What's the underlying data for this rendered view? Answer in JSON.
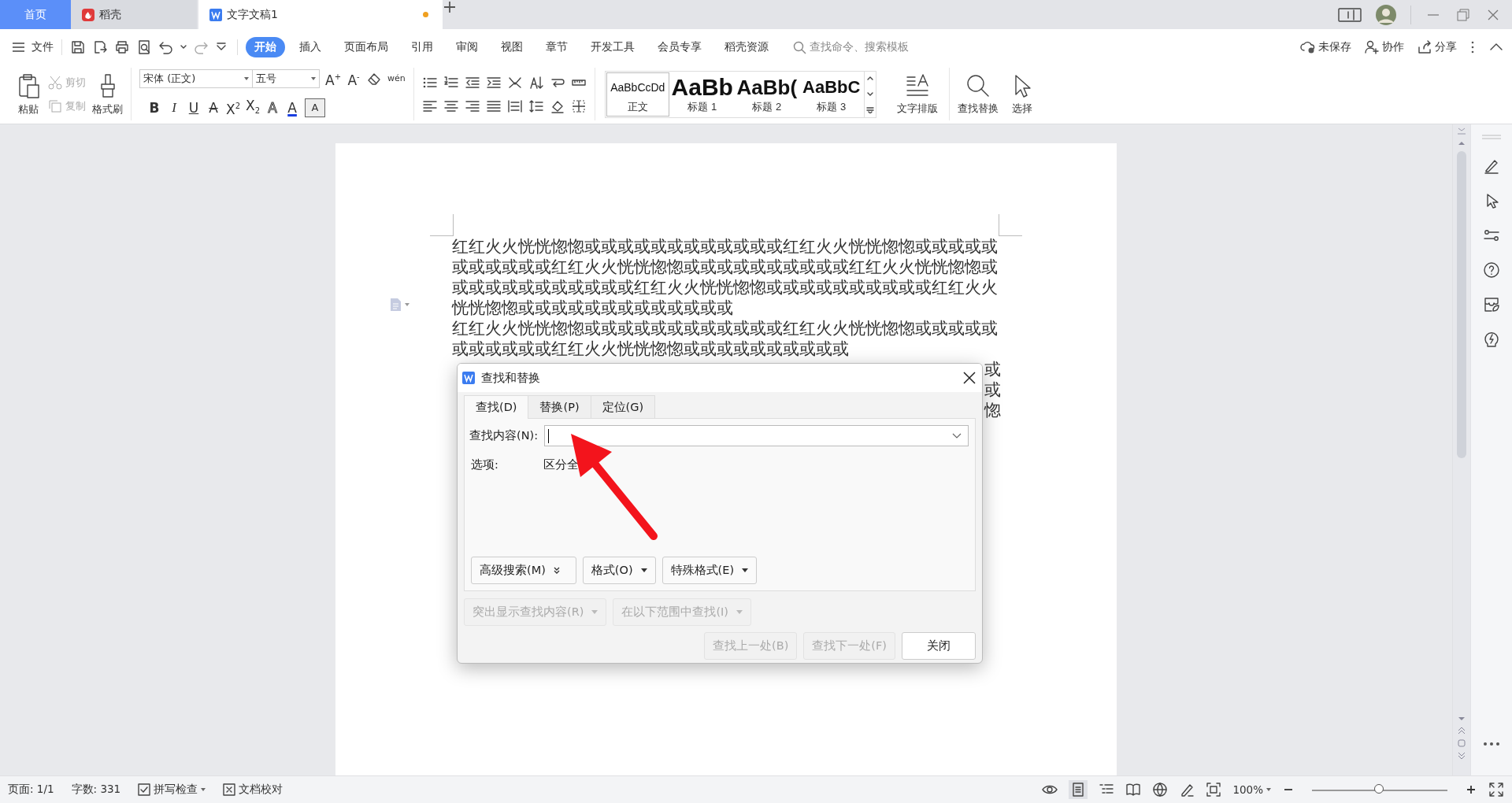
{
  "tabs": [
    {
      "label": "首页",
      "kind": "home",
      "selected": false
    },
    {
      "label": "稻壳",
      "kind": "app",
      "selected": false
    },
    {
      "label": "文字文稿1",
      "kind": "doc",
      "selected": true,
      "unsaved": true
    }
  ],
  "menu": {
    "file": "文件",
    "tabs": [
      {
        "label": "开始",
        "selected": true
      },
      {
        "label": "插入",
        "selected": false
      },
      {
        "label": "页面布局",
        "selected": false
      },
      {
        "label": "引用",
        "selected": false
      },
      {
        "label": "审阅",
        "selected": false
      },
      {
        "label": "视图",
        "selected": false
      },
      {
        "label": "章节",
        "selected": false
      },
      {
        "label": "开发工具",
        "selected": false
      },
      {
        "label": "会员专享",
        "selected": false
      },
      {
        "label": "稻壳资源",
        "selected": false
      }
    ],
    "search": {
      "placeholder": "查找命令、搜索模板"
    },
    "actions": [
      {
        "label": "未保存",
        "kind": "cloud"
      },
      {
        "label": "协作",
        "kind": "people"
      },
      {
        "label": "分享",
        "kind": "share"
      }
    ]
  },
  "ribbon": {
    "paste": "粘贴",
    "clip": [
      {
        "label": "剪切",
        "kind": "cut",
        "disabled": true
      },
      {
        "label": "复制",
        "kind": "copy",
        "disabled": true
      }
    ],
    "format_painter": "格式刷",
    "font": "宋体 (正文)",
    "size": "五号",
    "font_tools": [
      {
        "label": "B",
        "kind": "bold"
      },
      {
        "label": "I",
        "kind": "italic"
      },
      {
        "label": "U",
        "kind": "underline"
      },
      {
        "label": "A",
        "kind": "strike"
      },
      {
        "label": "X$^{2}$",
        "kind": "plain"
      },
      {
        "label": "X$_{2}$",
        "kind": "plain"
      },
      {
        "label": "A",
        "kind": "effect"
      },
      {
        "label": "A",
        "kind": "color"
      },
      {
        "label": "A",
        "kind": "boxed"
      }
    ],
    "grow_tools": [
      {
        "label": "A$^{+}$"
      },
      {
        "label": "A$^{-}$"
      }
    ],
    "pinyin": "wén",
    "styles": [
      {
        "preview": "AaBbCcDd",
        "label": "正文",
        "kind": "body",
        "selected": true
      },
      {
        "preview": "AaBb",
        "label": "标题 1",
        "kind": "h1",
        "selected": false
      },
      {
        "preview": "AaBb(",
        "label": "标题 2",
        "kind": "h2",
        "selected": false
      },
      {
        "preview": "AaBbC",
        "label": "标题 3",
        "kind": "h3",
        "selected": false
      }
    ],
    "text_layout": "文字排版",
    "find_replace": "查找替换",
    "select": "选择"
  },
  "document": {
    "paragraphs": [
      "红红火火恍恍惚惚或或或或或或或或或或或或红红火火恍恍惚惚或或或或或或或或或或或红红火火恍恍惚惚或或或或或或或或或或红红火火恍恍惚惚或或或或或或或或或或或或红红火火恍恍惚惚或或或或或或或或或或红红火火恍恍惚惚或或或或或或或或或或或或或",
      "红红火火恍恍惚惚或或或或或或或或或或或或红红火火恍恍惚惚或或或或或或或或或或或红红火火恍恍惚惚或或或或或或或或或或"
    ],
    "hidden_line_ends": [
      "或",
      "或",
      "惚"
    ]
  },
  "dialog": {
    "title": "查找和替换",
    "tabs": [
      {
        "label": "查找(D)",
        "selected": true
      },
      {
        "label": "替换(P)",
        "selected": false
      },
      {
        "label": "定位(G)",
        "selected": false
      }
    ],
    "find_label": "查找内容(N):",
    "options_label": "选项:",
    "options_value": "区分全",
    "buttons": [
      {
        "label": "高级搜索(M)",
        "kind": "expand"
      },
      {
        "label": "格式(O)",
        "kind": "dropdown"
      },
      {
        "label": "特殊格式(E)",
        "kind": "dropdown"
      }
    ],
    "menus": [
      {
        "label": "突出显示查找内容(R)",
        "disabled": true
      },
      {
        "label": "在以下范围中查找(I)",
        "disabled": true
      }
    ],
    "actions": [
      {
        "label": "查找上一处(B)",
        "disabled": true
      },
      {
        "label": "查找下一处(F)",
        "disabled": true
      },
      {
        "label": "关闭",
        "disabled": false
      }
    ]
  },
  "status_bar": {
    "page": "页面: 1/1",
    "words": "字数: 331",
    "spell": "拼写检查",
    "proofread": "文档校对",
    "zoom": "100%",
    "zoom_slider": {
      "level": 0.5
    }
  }
}
